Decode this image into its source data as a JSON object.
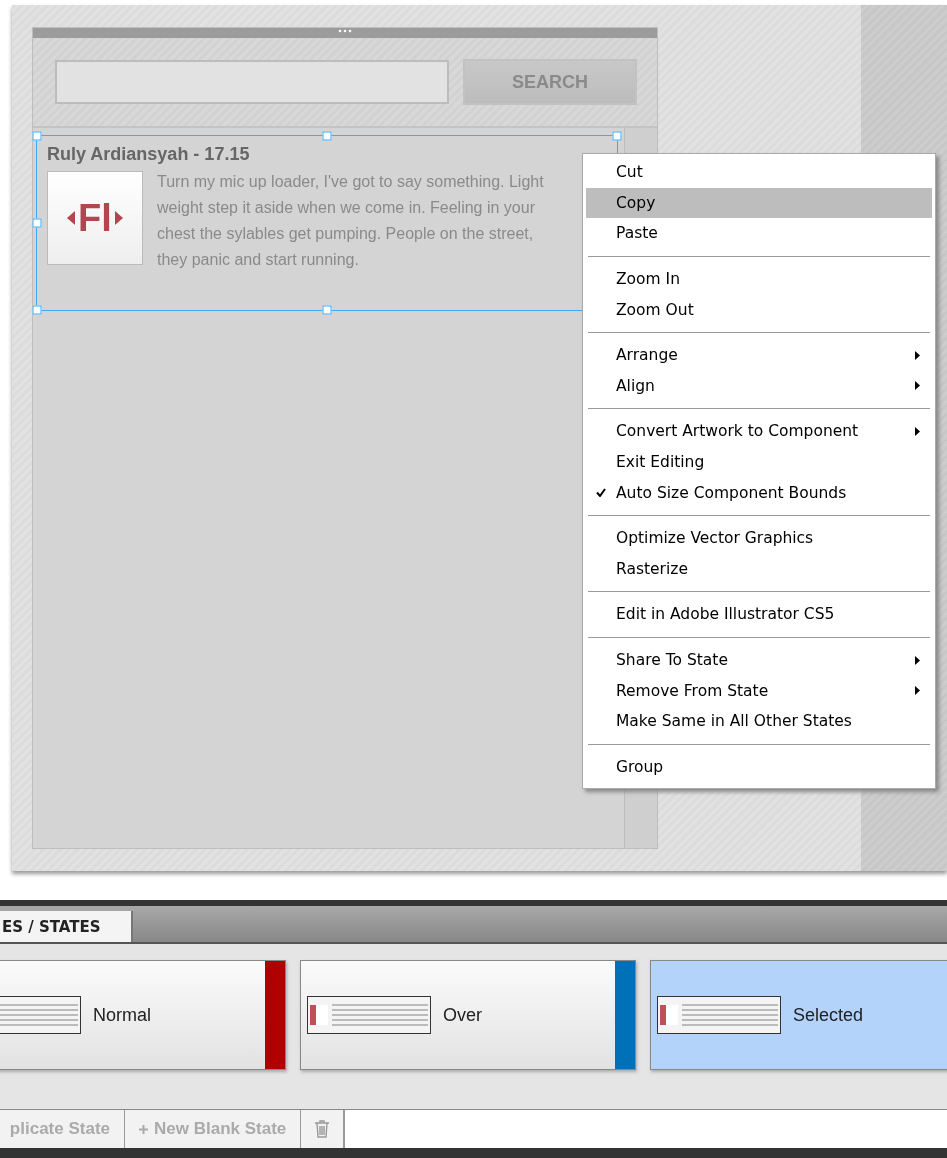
{
  "search": {
    "button": "SEARCH"
  },
  "list_item": {
    "title": "Ruly Ardiansyah - 17.15",
    "logo": "Fl",
    "body": "Turn my mic up loader, I've got to say something. Light weight step it aside when we come in. Feeling in your chest the sylables get pumping. People on the street, they panic and start running.",
    "selected": true
  },
  "context_menu": {
    "sections": [
      [
        {
          "label": "Cut",
          "highlighted": false,
          "checked": false,
          "submenu": false
        },
        {
          "label": "Copy",
          "highlighted": true,
          "checked": false,
          "submenu": false
        },
        {
          "label": "Paste",
          "highlighted": false,
          "checked": false,
          "submenu": false
        }
      ],
      [
        {
          "label": "Zoom In",
          "highlighted": false,
          "checked": false,
          "submenu": false
        },
        {
          "label": "Zoom Out",
          "highlighted": false,
          "checked": false,
          "submenu": false
        }
      ],
      [
        {
          "label": "Arrange",
          "highlighted": false,
          "checked": false,
          "submenu": true
        },
        {
          "label": "Align",
          "highlighted": false,
          "checked": false,
          "submenu": true
        }
      ],
      [
        {
          "label": "Convert Artwork to Component",
          "highlighted": false,
          "checked": false,
          "submenu": true
        },
        {
          "label": "Exit Editing",
          "highlighted": false,
          "checked": false,
          "submenu": false
        },
        {
          "label": "Auto Size Component Bounds",
          "highlighted": false,
          "checked": true,
          "submenu": false
        }
      ],
      [
        {
          "label": "Optimize Vector Graphics",
          "highlighted": false,
          "checked": false,
          "submenu": false
        },
        {
          "label": "Rasterize",
          "highlighted": false,
          "checked": false,
          "submenu": false
        }
      ],
      [
        {
          "label": "Edit in Adobe Illustrator CS5",
          "highlighted": false,
          "checked": false,
          "submenu": false
        }
      ],
      [
        {
          "label": "Share To State",
          "highlighted": false,
          "checked": false,
          "submenu": true
        },
        {
          "label": "Remove From State",
          "highlighted": false,
          "checked": false,
          "submenu": true
        },
        {
          "label": "Make Same in All Other States",
          "highlighted": false,
          "checked": false,
          "submenu": false
        }
      ],
      [
        {
          "label": "Group",
          "highlighted": false,
          "checked": false,
          "submenu": false
        }
      ]
    ]
  },
  "states_panel": {
    "tab": "ES / STATES",
    "states": [
      {
        "label": "Normal",
        "selected": false,
        "color": "#b00000"
      },
      {
        "label": "Over",
        "selected": false,
        "color": "#0070b8"
      },
      {
        "label": "Selected",
        "selected": true,
        "color": "#b3d3fb"
      }
    ],
    "buttons": [
      {
        "label": "plicate State",
        "kind": "text"
      },
      {
        "label": "New Blank State",
        "kind": "add"
      },
      {
        "kind": "delete"
      }
    ]
  }
}
